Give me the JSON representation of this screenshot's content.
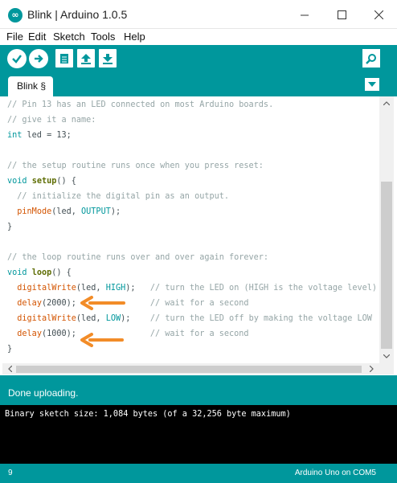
{
  "window": {
    "title": "Blink | Arduino 1.0.5",
    "minimize_glyph": "—",
    "maximize_glyph": "☐",
    "close_glyph": "✕"
  },
  "menu": {
    "items": [
      "File",
      "Edit",
      "Sketch",
      "Tools",
      "Help"
    ]
  },
  "toolbar": {
    "icons": [
      "verify-icon",
      "upload-icon",
      "new-icon",
      "open-icon",
      "save-icon",
      "serial-monitor-icon"
    ],
    "accent_color": "#00979c"
  },
  "tabs": {
    "active_label": "Blink §"
  },
  "code": {
    "lines": [
      [
        [
          "// Pin 13 has an LED connected on most Arduino boards.",
          "c-comment"
        ]
      ],
      [
        [
          "// give it a name:",
          "c-comment"
        ]
      ],
      [
        [
          "int",
          "c-type"
        ],
        [
          " led = 13;",
          "c-plain"
        ]
      ],
      [],
      [
        [
          "// the setup routine runs once when you press reset:",
          "c-comment"
        ]
      ],
      [
        [
          "void",
          "c-type"
        ],
        [
          " ",
          "c-plain"
        ],
        [
          "setup",
          "c-func-b"
        ],
        [
          "() {",
          "c-plain"
        ]
      ],
      [
        [
          "  // initialize the digital pin as an output.",
          "c-comment"
        ]
      ],
      [
        [
          "  ",
          "c-plain"
        ],
        [
          "pinMode",
          "c-func"
        ],
        [
          "(led, ",
          "c-plain"
        ],
        [
          "OUTPUT",
          "c-const"
        ],
        [
          ");",
          "c-plain"
        ]
      ],
      [
        [
          "}",
          "c-plain"
        ]
      ],
      [],
      [
        [
          "// the loop routine runs over and over again forever:",
          "c-comment"
        ]
      ],
      [
        [
          "void",
          "c-type"
        ],
        [
          " ",
          "c-plain"
        ],
        [
          "loop",
          "c-func-b"
        ],
        [
          "() {",
          "c-plain"
        ]
      ],
      [
        [
          "  ",
          "c-plain"
        ],
        [
          "digitalWrite",
          "c-func"
        ],
        [
          "(led, ",
          "c-plain"
        ],
        [
          "HIGH",
          "c-const"
        ],
        [
          ");   ",
          "c-plain"
        ],
        [
          "// turn the LED on (HIGH is the voltage level)",
          "c-comment"
        ]
      ],
      [
        [
          "  ",
          "c-plain"
        ],
        [
          "delay",
          "c-func"
        ],
        [
          "(2000);               ",
          "c-plain"
        ],
        [
          "// wait for a second",
          "c-comment"
        ]
      ],
      [
        [
          "  ",
          "c-plain"
        ],
        [
          "digitalWrite",
          "c-func"
        ],
        [
          "(led, ",
          "c-plain"
        ],
        [
          "LOW",
          "c-const"
        ],
        [
          ");    ",
          "c-plain"
        ],
        [
          "// turn the LED off by making the voltage LOW",
          "c-comment"
        ]
      ],
      [
        [
          "  ",
          "c-plain"
        ],
        [
          "delay",
          "c-func"
        ],
        [
          "(1000);               ",
          "c-plain"
        ],
        [
          "// wait for a second",
          "c-comment"
        ]
      ],
      [
        [
          "}",
          "c-plain"
        ]
      ]
    ],
    "annotation_color": "#f28c28"
  },
  "status": {
    "message": "Done uploading."
  },
  "console": {
    "text": "Binary sketch size: 1,084 bytes (of a 32,256 byte maximum)"
  },
  "footer": {
    "line_number": "9",
    "board": "Arduino Uno on COM5"
  }
}
